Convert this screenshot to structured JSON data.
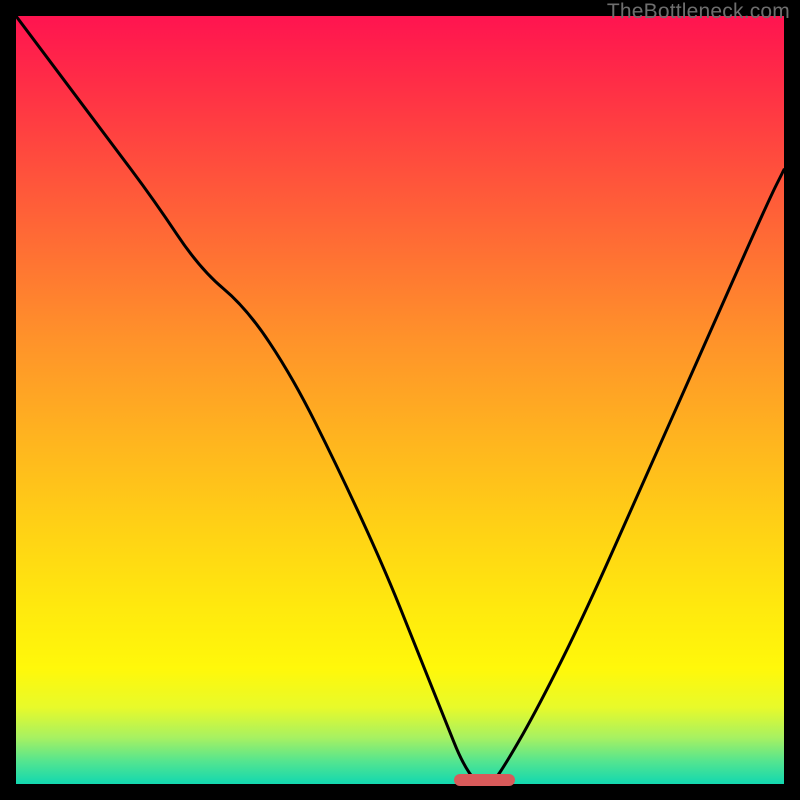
{
  "watermark": "TheBottleneck.com",
  "chart_data": {
    "type": "line",
    "title": "",
    "xlabel": "",
    "ylabel": "",
    "xlim": [
      0,
      100
    ],
    "ylim": [
      0,
      100
    ],
    "series": [
      {
        "name": "bottleneck-curve",
        "x": [
          0,
          6,
          12,
          18,
          24,
          30,
          36,
          42,
          48,
          52,
          56,
          58,
          60,
          62,
          64,
          68,
          74,
          82,
          90,
          98,
          100
        ],
        "values": [
          100,
          92,
          84,
          76,
          67,
          62,
          53,
          41,
          28,
          18,
          8,
          3,
          0,
          0,
          3,
          10,
          22,
          40,
          58,
          76,
          80
        ]
      }
    ],
    "marker": {
      "x_start": 57,
      "x_end": 65,
      "y": 0
    },
    "annotations": []
  },
  "colors": {
    "curve": "#000000",
    "marker": "#d85a5a",
    "frame": "#000000"
  }
}
